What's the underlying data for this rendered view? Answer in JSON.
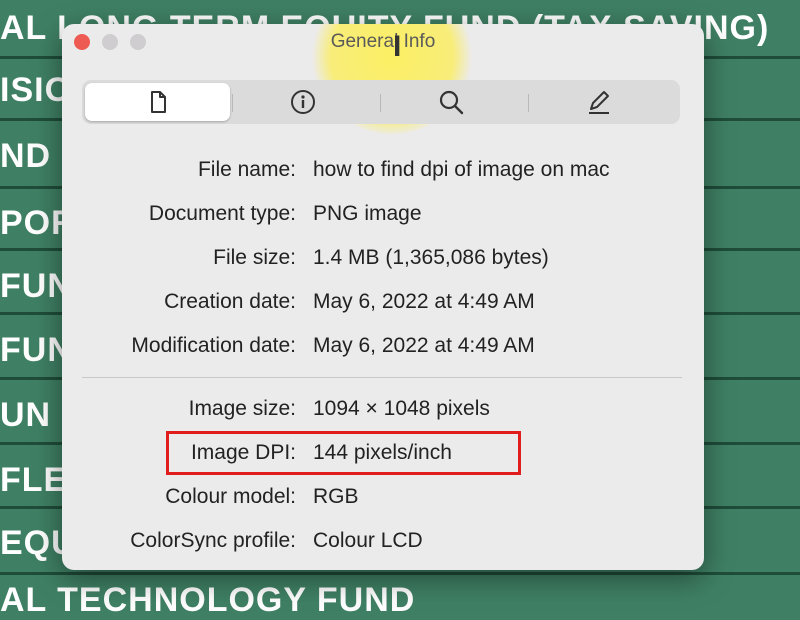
{
  "background": {
    "rows": [
      "AL LONG TERM EQUITY FUND (TAX SAVING)",
      "ISIO",
      "ND",
      "PORT",
      "FUNI",
      "FUND",
      "UN L",
      "FLE",
      "EQU",
      "AL TECHNOLOGY FUND"
    ]
  },
  "window": {
    "title": "General Info",
    "tabs": [
      {
        "icon": "document-icon"
      },
      {
        "icon": "info-icon"
      },
      {
        "icon": "search-icon"
      },
      {
        "icon": "pencil-icon"
      }
    ],
    "fields": [
      {
        "label": "File name:",
        "value": "how to find dpi of image on mac"
      },
      {
        "label": "Document type:",
        "value": "PNG image"
      },
      {
        "label": "File size:",
        "value": "1.4 MB (1,365,086 bytes)"
      },
      {
        "label": "Creation date:",
        "value": "May 6, 2022 at 4:49 AM"
      },
      {
        "label": "Modification date:",
        "value": "May 6, 2022 at 4:49 AM"
      }
    ],
    "image_fields": [
      {
        "label": "Image size:",
        "value": "1094 × 1048 pixels"
      },
      {
        "label": "Image DPI:",
        "value": "144 pixels/inch"
      },
      {
        "label": "Colour model:",
        "value": "RGB"
      },
      {
        "label": "ColorSync profile:",
        "value": "Colour LCD"
      }
    ]
  },
  "colors": {
    "highlight": "#e01c1c",
    "background": "#3f8064",
    "window": "#ecebec"
  }
}
